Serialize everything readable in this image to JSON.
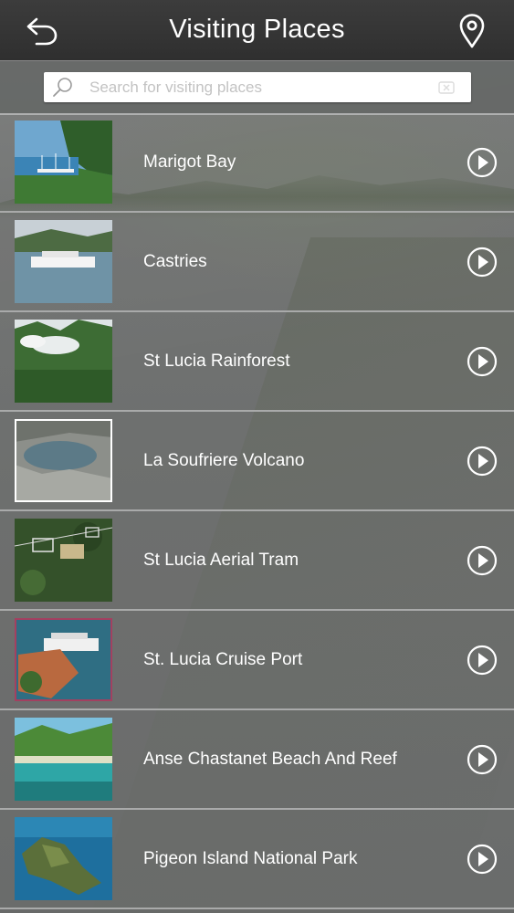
{
  "header": {
    "title": "Visiting Places",
    "back_icon": "back-arrow-icon",
    "map_icon": "map-pin-icon"
  },
  "search": {
    "placeholder": "Search for visiting places",
    "value": ""
  },
  "places": [
    {
      "name": "Marigot Bay"
    },
    {
      "name": "Castries"
    },
    {
      "name": "St Lucia Rainforest"
    },
    {
      "name": "La Soufriere Volcano"
    },
    {
      "name": "St Lucia Aerial Tram"
    },
    {
      "name": "St. Lucia Cruise Port"
    },
    {
      "name": "Anse Chastanet Beach And Reef"
    },
    {
      "name": "Pigeon Island National Park"
    }
  ],
  "colors": {
    "header_bg": "#343434",
    "row_divider": "#a9aaaa",
    "text": "#ffffff"
  }
}
